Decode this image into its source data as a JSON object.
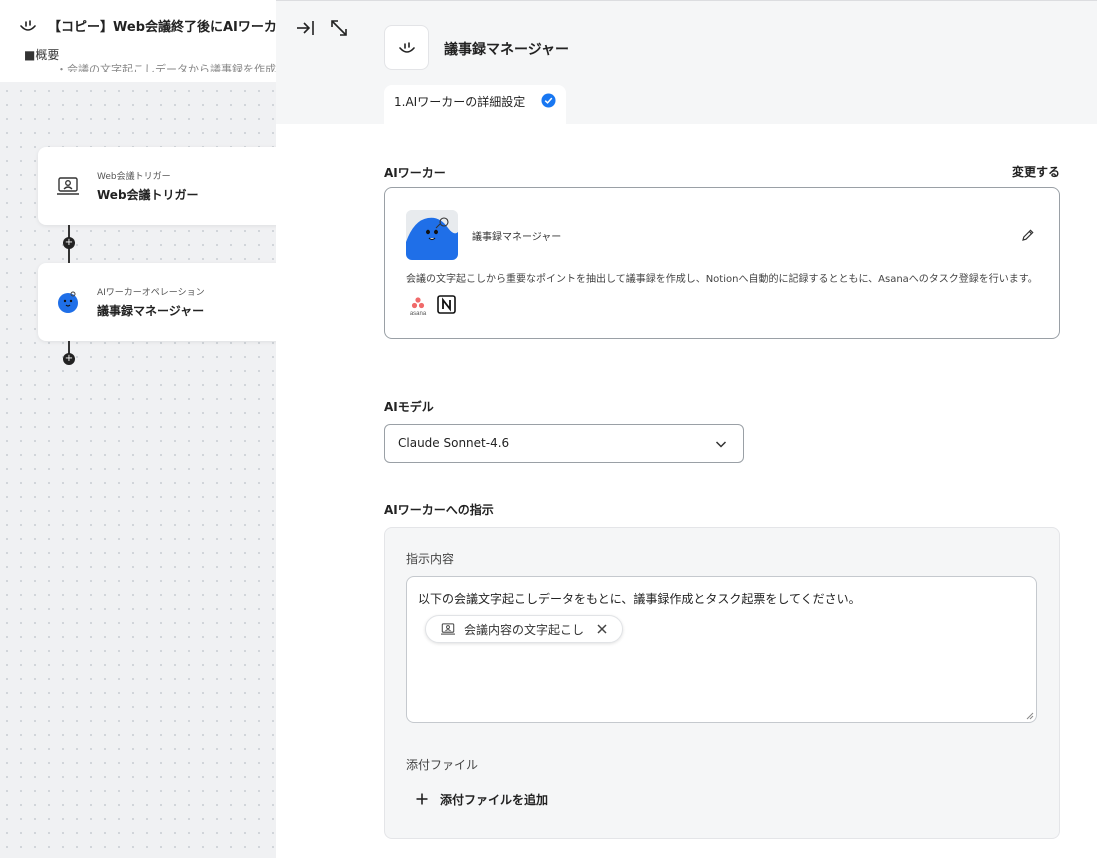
{
  "flow": {
    "title": "【コピー】Web会議終了後にAIワーカーが",
    "overview_label": "■概要",
    "overview_text": "・会議の文字起こしデータから議事録を作成し",
    "nodes": [
      {
        "small": "Web会議トリガー",
        "main": "Web会議トリガー",
        "icon": "video-meeting-icon"
      },
      {
        "small": "AIワーカーオペレーション",
        "main": "議事録マネージャー",
        "icon": "ai-worker-blob-icon"
      }
    ],
    "connector_icon": "plus-icon"
  },
  "panel": {
    "title": "議事録マネージャー",
    "step_tab": "1.AIワーカーの詳細設定",
    "step_done_icon": "check-circle-icon",
    "dock_icon": "dock-right-icon",
    "expand_icon": "expand-icon",
    "ai_worker_section": {
      "label": "AIワーカー",
      "change_link": "変更する",
      "worker_name": "議事録マネージャー",
      "description": "会議の文字起こしから重要なポイントを抽出して議事録を作成し、Notionへ自動的に記録するとともに、Asanaへのタスク登録を行います。",
      "tools": [
        "asana",
        "notion"
      ],
      "edit_icon": "pencil-icon"
    },
    "model_section": {
      "label": "AIモデル",
      "selected": "Claude Sonnet-4.6"
    },
    "instruction_section": {
      "label": "AIワーカーへの指示",
      "content_label": "指示内容",
      "instruction_text": "以下の会議文字起こしデータをもとに、議事録作成とタスク起票をしてください。",
      "chip_label": "会議内容の文字起こし",
      "attachment_label": "添付ファイル",
      "add_attachment": "添付ファイルを追加"
    }
  },
  "colors": {
    "accent_blue": "#1877f2",
    "worker_blue": "#1f6fe8",
    "asana_red": "#f06a6a"
  }
}
